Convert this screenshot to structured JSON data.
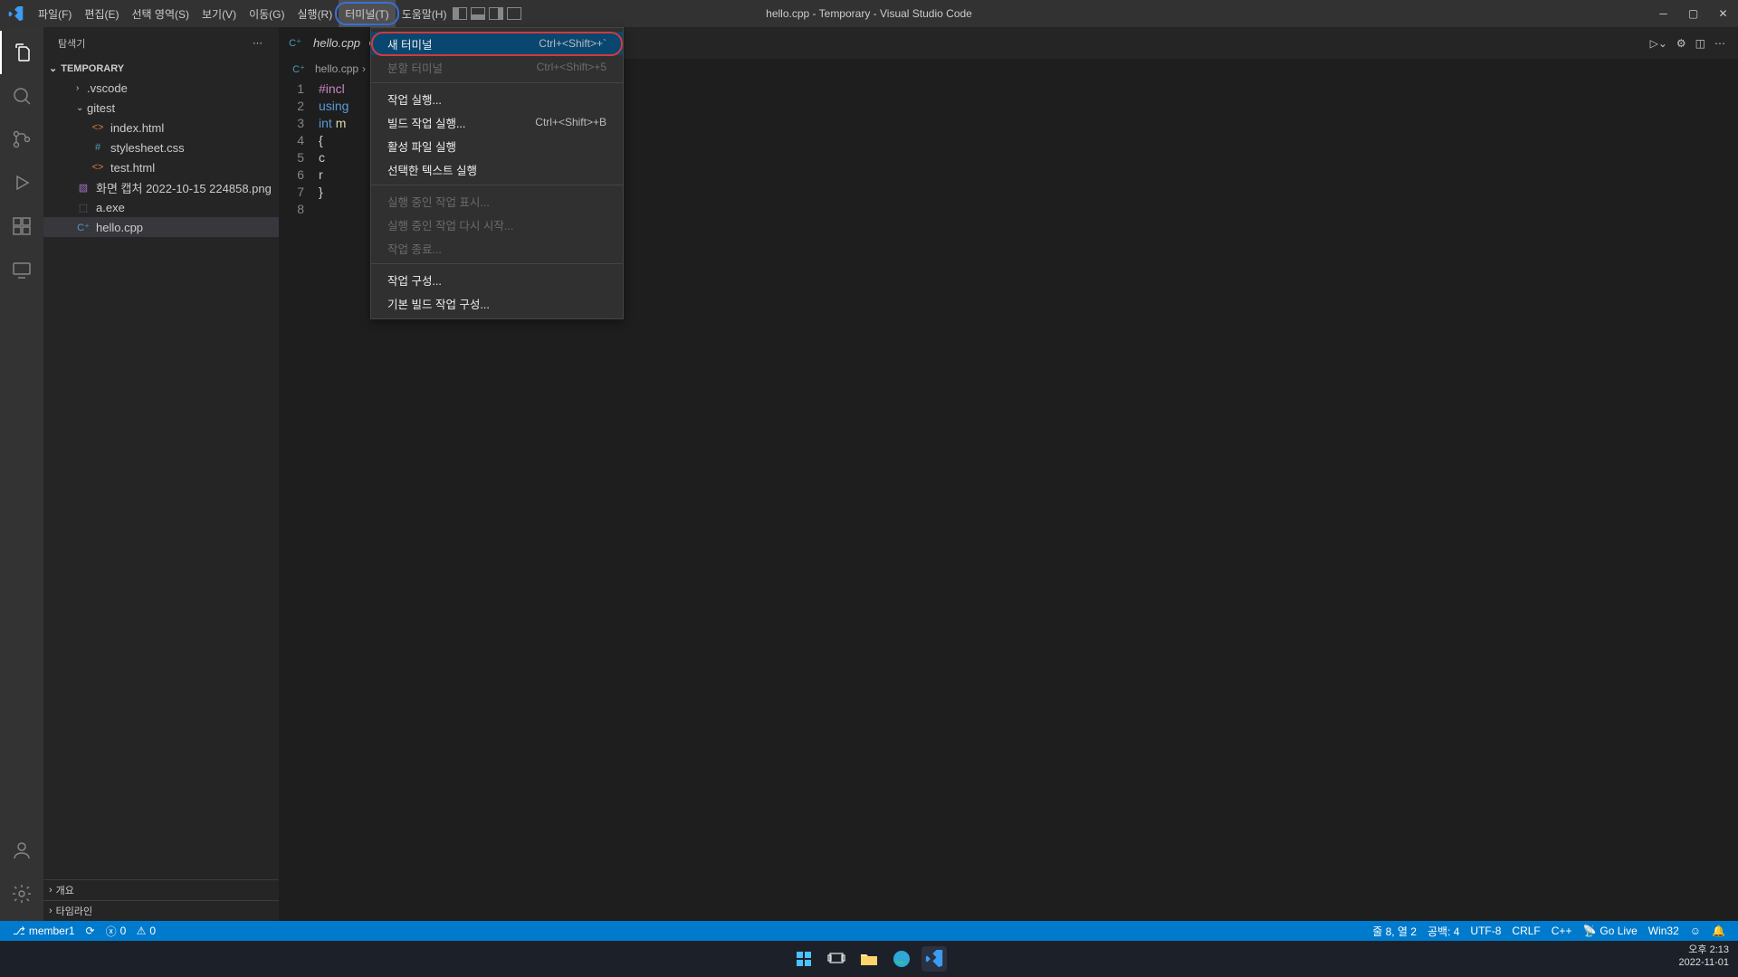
{
  "titlebar": {
    "menus": [
      "파일(F)",
      "편집(E)",
      "선택 영역(S)",
      "보기(V)",
      "이동(G)",
      "실행(R)",
      "터미널(T)",
      "도움말(H)"
    ],
    "title": "hello.cpp - Temporary - Visual Studio Code"
  },
  "sidebar": {
    "title": "탐색기",
    "root": "TEMPORARY",
    "items": [
      {
        "label": ".vscode",
        "type": "folder",
        "depth": 2,
        "chev": "›"
      },
      {
        "label": "gitest",
        "type": "folder-open",
        "depth": 2,
        "chev": "⌄"
      },
      {
        "label": "index.html",
        "type": "html",
        "depth": 3
      },
      {
        "label": "stylesheet.css",
        "type": "css",
        "depth": 3
      },
      {
        "label": "test.html",
        "type": "html",
        "depth": 3
      },
      {
        "label": "화면 캡처 2022-10-15 224858.png",
        "type": "img",
        "depth": 2
      },
      {
        "label": "a.exe",
        "type": "exe",
        "depth": 2
      },
      {
        "label": "hello.cpp",
        "type": "cpp",
        "depth": 2,
        "selected": true
      }
    ],
    "outline": "개요",
    "timeline": "타임라인"
  },
  "tabs": {
    "active": {
      "icon": "cpp",
      "label": "hello.cpp",
      "dirty": true
    }
  },
  "breadcrumb": {
    "icon": "cpp",
    "file": "hello.cpp",
    "sep": "›"
  },
  "code": {
    "lines": [
      "#incl",
      "using",
      "",
      "int m",
      "{",
      "    c",
      "    r",
      "}"
    ]
  },
  "ctxmenu": [
    {
      "label": "새 터미널",
      "kbd": "Ctrl+<Shift>+`",
      "hover": true,
      "circled": true
    },
    {
      "label": "분할 터미널",
      "kbd": "Ctrl+<Shift>+5",
      "disabled": true
    },
    {
      "sep": true
    },
    {
      "label": "작업 실행..."
    },
    {
      "label": "빌드 작업 실행...",
      "kbd": "Ctrl+<Shift>+B"
    },
    {
      "label": "활성 파일 실행"
    },
    {
      "label": "선택한 텍스트 실행"
    },
    {
      "sep": true
    },
    {
      "label": "실행 중인 작업 표시...",
      "disabled": true
    },
    {
      "label": "실행 중인 작업 다시 시작...",
      "disabled": true
    },
    {
      "label": "작업 종료...",
      "disabled": true
    },
    {
      "sep": true
    },
    {
      "label": "작업 구성..."
    },
    {
      "label": "기본 빌드 작업 구성..."
    }
  ],
  "statusbar": {
    "branch": "member1",
    "sync": "⟳",
    "errors": "0",
    "warnings": "0",
    "lnCol": "줄 8, 열 2",
    "spaces": "공백: 4",
    "encoding": "UTF-8",
    "eol": "CRLF",
    "lang": "C++",
    "golive": "Go Live",
    "os": "Win32",
    "bell": "🔔"
  },
  "taskbar": {
    "time": "오후 2:13",
    "date": "2022-11-01"
  }
}
